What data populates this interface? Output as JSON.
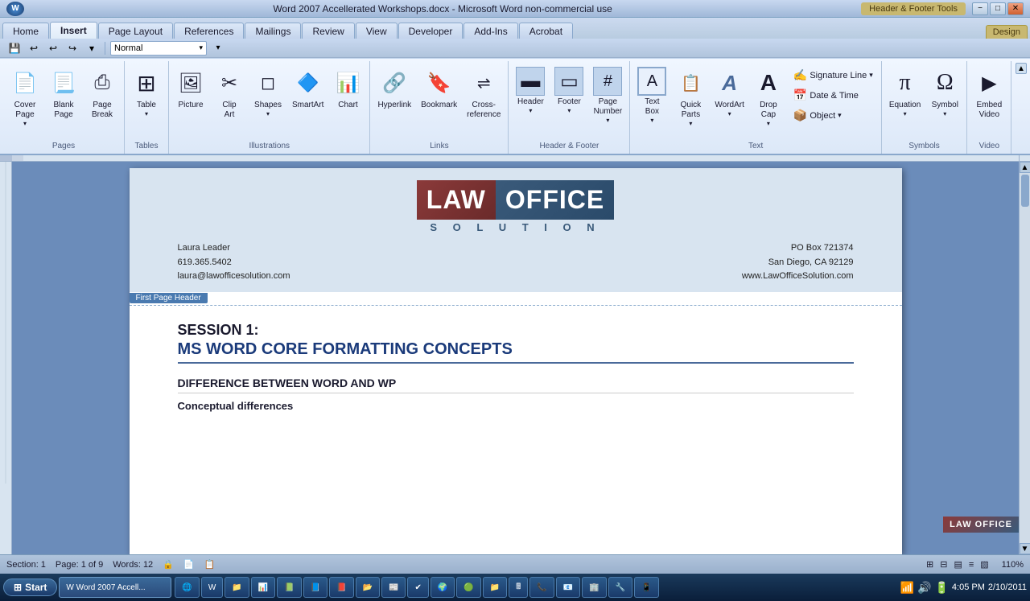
{
  "titlebar": {
    "title": "Word 2007 Accellerated Workshops.docx - Microsoft Word non-commercial use",
    "win_controls": [
      "−",
      "□",
      "✕"
    ],
    "header_tools_label": "Header & Footer Tools"
  },
  "tabs": {
    "items": [
      "Home",
      "Insert",
      "Page Layout",
      "References",
      "Mailings",
      "Review",
      "View",
      "Developer",
      "Add-Ins",
      "Acrobat",
      "Design"
    ],
    "active": "Insert",
    "contextual": "Design"
  },
  "ribbon": {
    "groups": {
      "pages": {
        "label": "Pages",
        "buttons": [
          {
            "id": "cover-page",
            "label": "Cover\nPage",
            "icon": "📄"
          },
          {
            "id": "blank-page",
            "label": "Blank\nPage",
            "icon": "📃"
          },
          {
            "id": "page-break",
            "label": "Page\nBreak",
            "icon": "⎙"
          }
        ]
      },
      "tables": {
        "label": "Tables",
        "buttons": [
          {
            "id": "table",
            "label": "Table",
            "icon": "⊞"
          }
        ]
      },
      "illustrations": {
        "label": "Illustrations",
        "buttons": [
          {
            "id": "picture",
            "label": "Picture",
            "icon": "🖼"
          },
          {
            "id": "clip-art",
            "label": "Clip\nArt",
            "icon": "✂"
          },
          {
            "id": "shapes",
            "label": "Shapes",
            "icon": "◻"
          },
          {
            "id": "smart-art",
            "label": "SmartArt",
            "icon": "🔷"
          },
          {
            "id": "chart",
            "label": "Chart",
            "icon": "📊"
          }
        ]
      },
      "links": {
        "label": "Links",
        "buttons": [
          {
            "id": "hyperlink",
            "label": "Hyperlink",
            "icon": "🔗"
          },
          {
            "id": "bookmark",
            "label": "Bookmark",
            "icon": "🔖"
          },
          {
            "id": "cross-reference",
            "label": "Cross-reference",
            "icon": "⇌"
          }
        ]
      },
      "header-footer": {
        "label": "Header & Footer",
        "buttons": [
          {
            "id": "header",
            "label": "Header",
            "icon": "▬"
          },
          {
            "id": "footer",
            "label": "Footer",
            "icon": "▭"
          },
          {
            "id": "page-number",
            "label": "Page\nNumber",
            "icon": "#"
          }
        ]
      },
      "text": {
        "label": "Text",
        "buttons": [
          {
            "id": "text-box",
            "label": "Text\nBox",
            "icon": "⬜"
          },
          {
            "id": "quick-parts",
            "label": "Quick\nParts",
            "icon": "📋"
          },
          {
            "id": "word-art",
            "label": "WordArt",
            "icon": "A"
          },
          {
            "id": "drop-cap",
            "label": "Drop\nCap",
            "icon": "A"
          }
        ],
        "small_buttons": [
          {
            "id": "signature-line",
            "label": "Signature Line",
            "icon": "✍"
          },
          {
            "id": "date-time",
            "label": "Date & Time",
            "icon": "📅"
          },
          {
            "id": "object",
            "label": "Object",
            "icon": "📦"
          }
        ]
      },
      "symbols": {
        "label": "Symbols",
        "buttons": [
          {
            "id": "equation",
            "label": "Equation",
            "icon": "π"
          },
          {
            "id": "symbol",
            "label": "Symbol",
            "icon": "Ω"
          }
        ]
      },
      "video": {
        "label": "Video",
        "buttons": [
          {
            "id": "embed-video",
            "label": "Embed\nVideo",
            "icon": "▶"
          }
        ]
      }
    }
  },
  "qat": {
    "save_icon": "💾",
    "undo_icon": "↩",
    "redo_icon": "↪",
    "customize_icon": "▾",
    "style_value": "Normal"
  },
  "document": {
    "header": {
      "company": "LAW OFFICE",
      "tagline": "S O L U T I O N",
      "contact_left": {
        "name": "Laura Leader",
        "phone": "619.365.5402",
        "email": "laura@lawofficesolution.com"
      },
      "contact_right": {
        "po_box": "PO Box 721374",
        "city_state": "San Diego, CA 92129",
        "website": "www.LawOfficeSolution.com"
      },
      "label": "First Page Header"
    },
    "body": {
      "session_heading": "SESSION 1:",
      "session_subheading": "MS WORD CORE FORMATTING CONCEPTS",
      "section_heading": "DIFFERENCE BETWEEN WORD AND WP",
      "conceptual_heading": "Conceptual differences"
    }
  },
  "statusbar": {
    "section": "Section: 1",
    "page": "Page: 1 of 9",
    "words": "Words: 12",
    "icons": [
      "🔒",
      "📄",
      "📋"
    ],
    "zoom": "110%",
    "view_icons": [
      "⊞",
      "⊟",
      "▤",
      "≡",
      "▧"
    ]
  },
  "taskbar": {
    "start_label": "Start",
    "start_icon": "⊞",
    "apps": [
      {
        "label": "Word 2007...",
        "icon": "W",
        "active": true
      },
      {
        "icon": "🌐"
      },
      {
        "icon": "W"
      },
      {
        "icon": "📁"
      },
      {
        "icon": "📊"
      },
      {
        "icon": "📗"
      },
      {
        "icon": "📘"
      },
      {
        "icon": "📕"
      },
      {
        "icon": "📂"
      },
      {
        "icon": "📰"
      },
      {
        "icon": "✔"
      },
      {
        "icon": "🌍"
      },
      {
        "icon": "🟢"
      },
      {
        "icon": "📁"
      },
      {
        "icon": "🖩"
      },
      {
        "icon": "📞"
      },
      {
        "icon": "📧"
      },
      {
        "icon": "🏢"
      },
      {
        "icon": "🔧"
      },
      {
        "icon": "📱"
      }
    ],
    "time": "4:05 PM",
    "date": "2/10/2011"
  }
}
